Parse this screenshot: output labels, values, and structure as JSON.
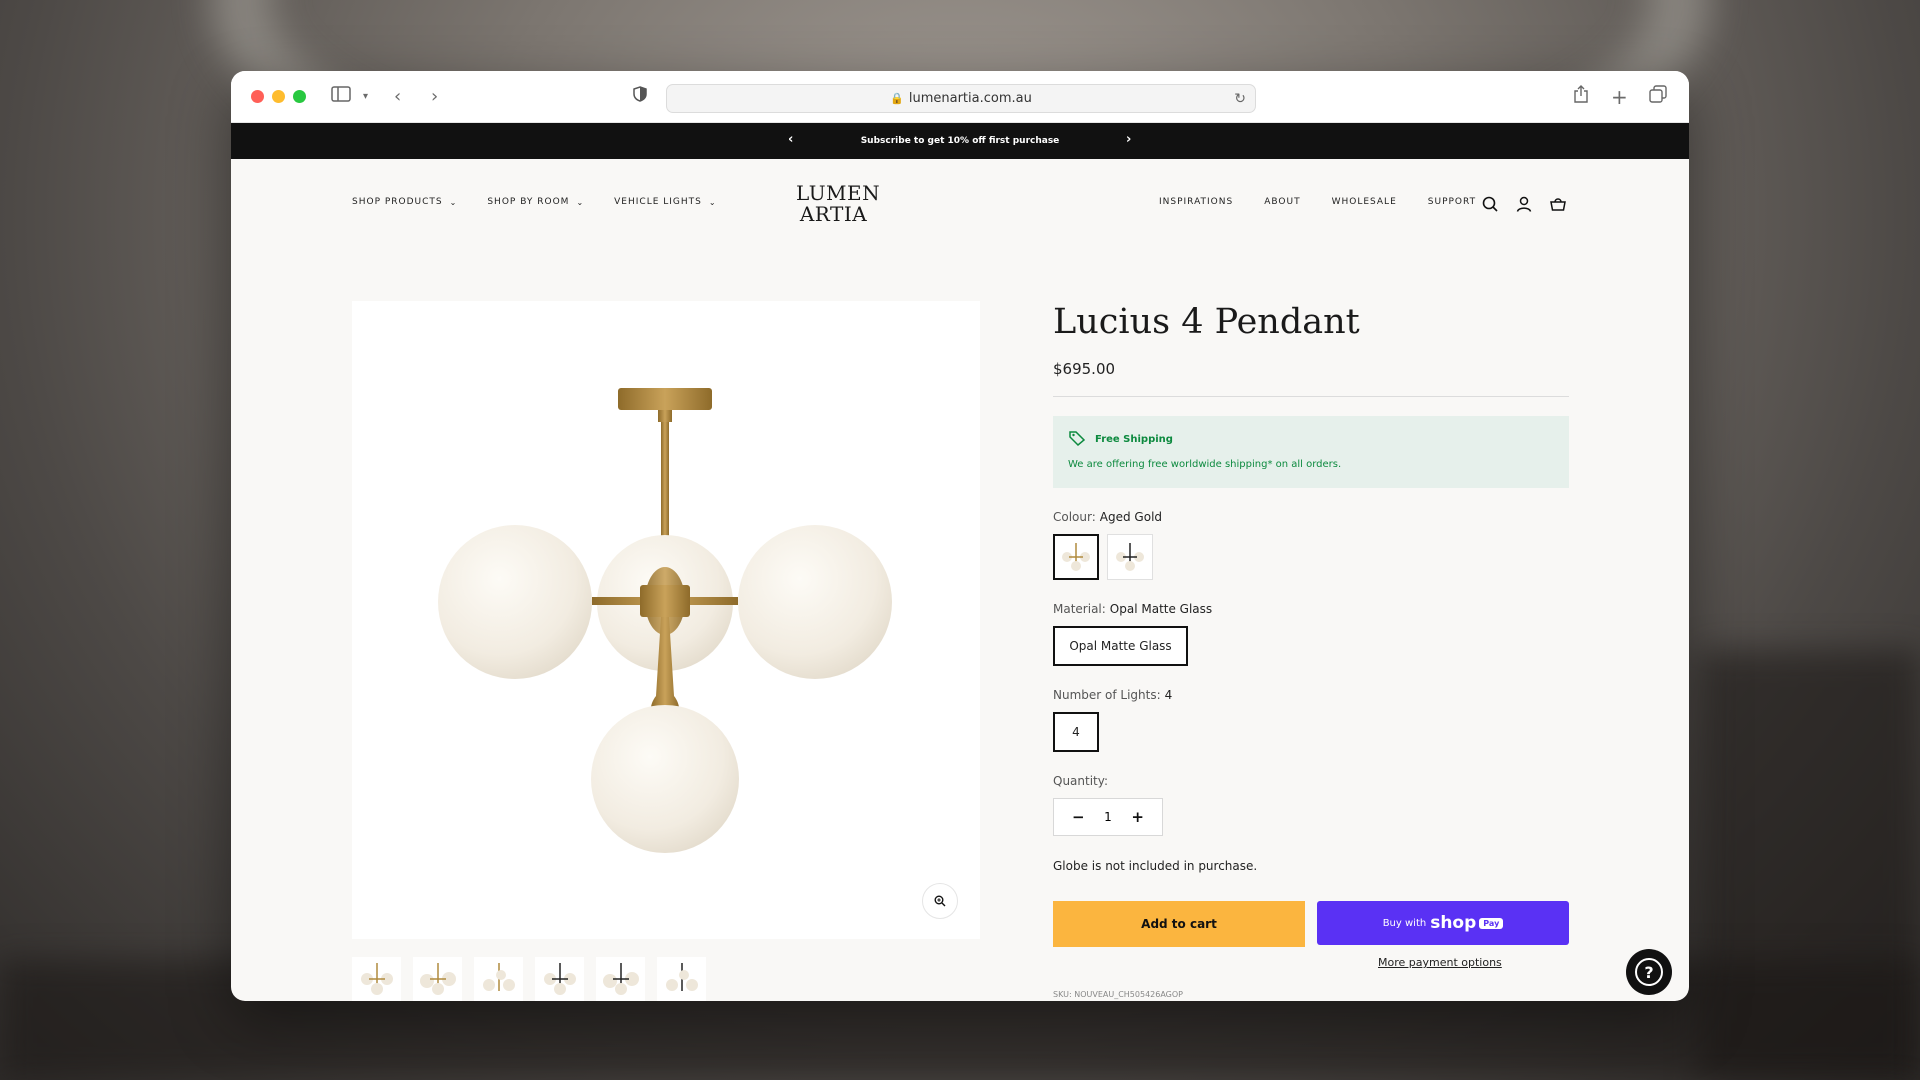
{
  "browser": {
    "url": "lumenartia.com.au"
  },
  "announcement": {
    "text": "Subscribe to get 10% off first purchase"
  },
  "header": {
    "logo_line1": "LUMEN",
    "logo_line2": "ARTIA",
    "nav_left": [
      "SHOP PRODUCTS",
      "SHOP BY ROOM",
      "VEHICLE LIGHTS"
    ],
    "nav_right": [
      "INSPIRATIONS",
      "ABOUT",
      "WHOLESALE",
      "SUPPORT"
    ]
  },
  "product": {
    "title": "Lucius 4 Pendant",
    "price": "$695.00",
    "shipping_title": "Free Shipping",
    "shipping_text": "We are offering free worldwide shipping* on all orders.",
    "colour_label": "Colour:",
    "colour_value": "Aged Gold",
    "material_label": "Material:",
    "material_value": "Opal Matte Glass",
    "material_option": "Opal Matte Glass",
    "lights_label": "Number of Lights:",
    "lights_value": "4",
    "lights_option": "4",
    "quantity_label": "Quantity:",
    "quantity_value": "1",
    "note": "Globe is not included in purchase.",
    "add_to_cart": "Add to cart",
    "buy_with": "Buy with",
    "shop_word": "shop",
    "pay_word": "Pay",
    "more_payment": "More payment options",
    "sku": "SKU: NOUVEAU_CH505426AGOP"
  },
  "colors": {
    "accent_cart": "#fbb53f",
    "shop_pay": "#5a31f4",
    "shipping_green": "#0d8a3f",
    "gold": "#b08a3e"
  },
  "icons": [
    "search-icon",
    "account-icon",
    "cart-icon",
    "zoom-icon",
    "tag-icon",
    "help-icon"
  ]
}
